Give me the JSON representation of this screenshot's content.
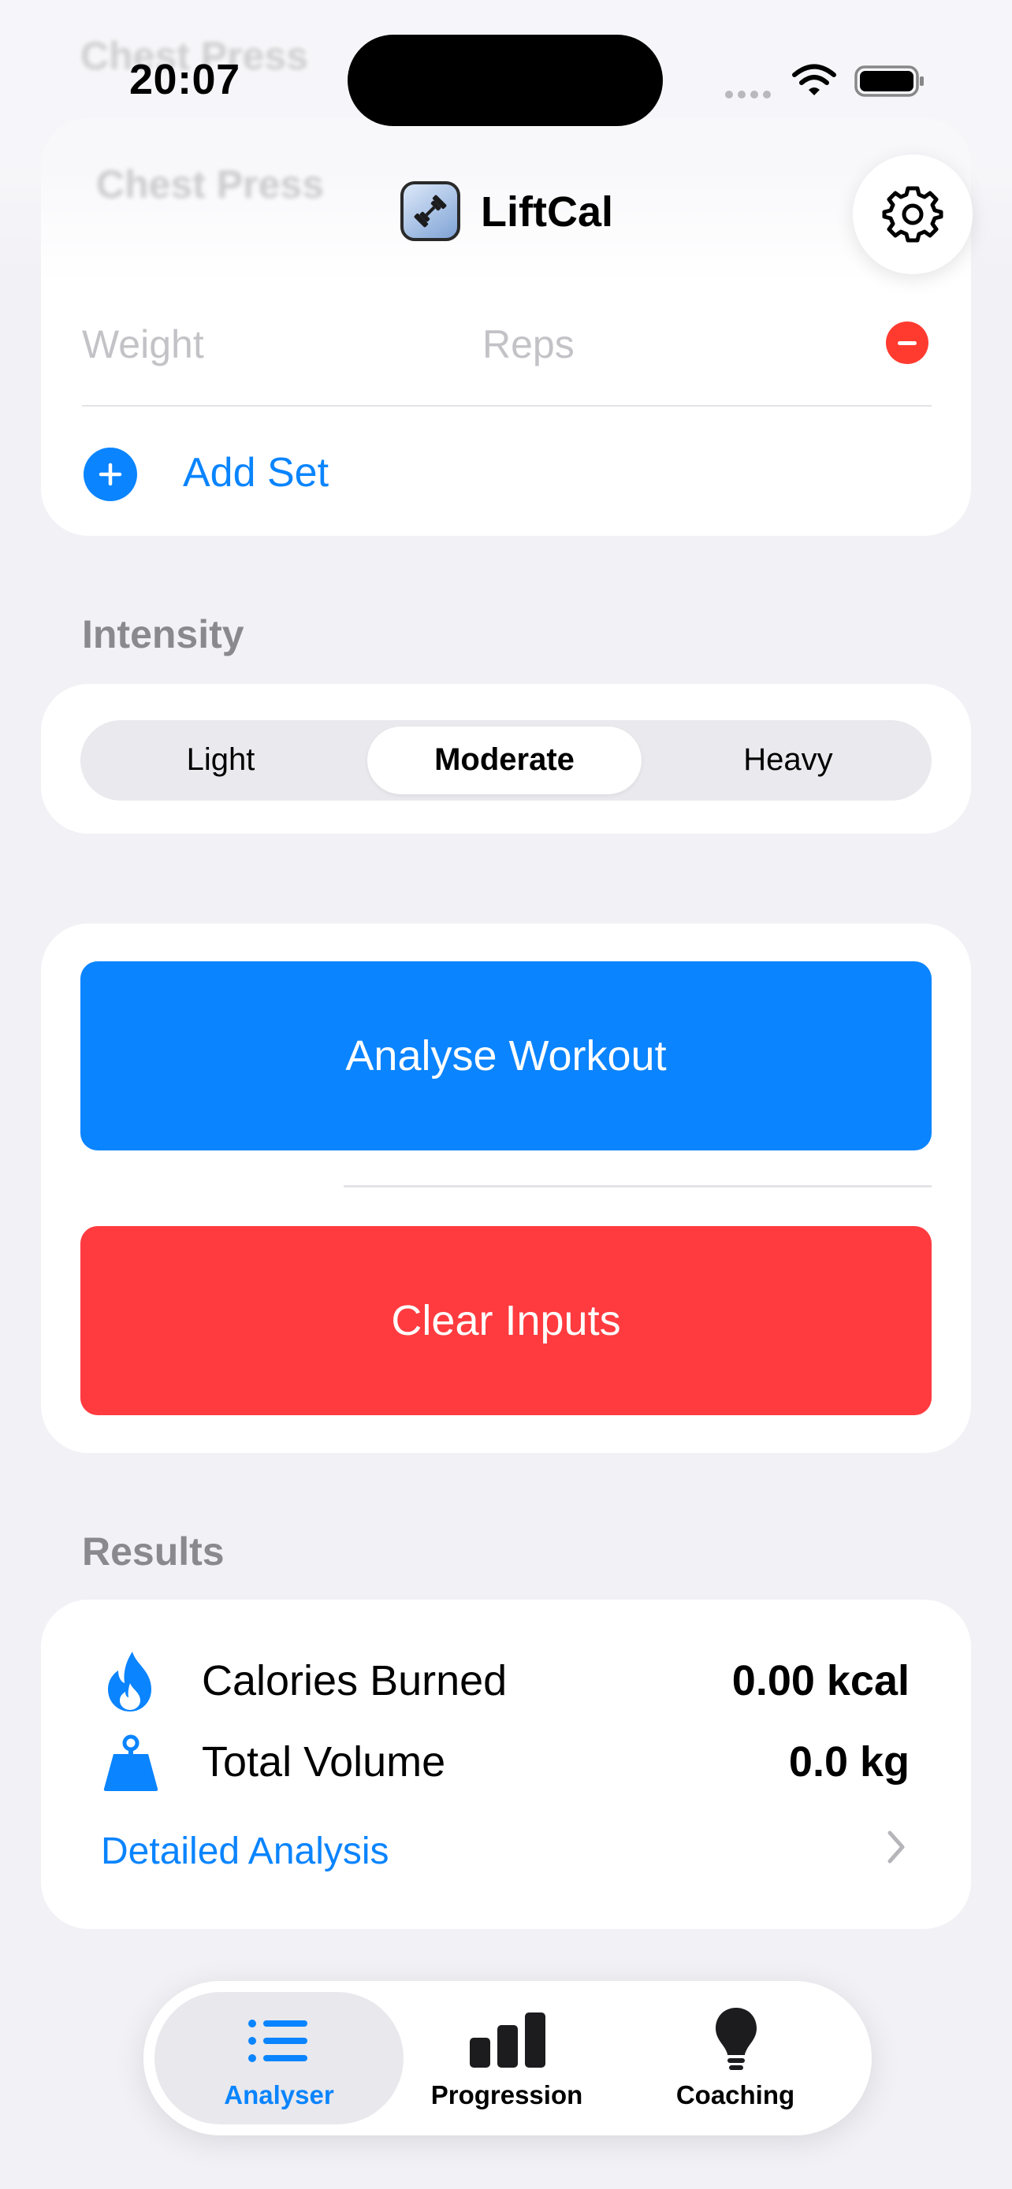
{
  "background_header": {
    "ghost_title": "Chest Press",
    "ghost_field": "Chest Press"
  },
  "status_bar": {
    "time": "20:07"
  },
  "nav": {
    "app_name": "LiftCal",
    "settings_icon": "gear-icon"
  },
  "sets": {
    "weight_placeholder": "Weight",
    "reps_placeholder": "Reps",
    "add_set_label": "Add Set"
  },
  "intensity": {
    "section_label": "Intensity",
    "options": [
      "Light",
      "Moderate",
      "Heavy"
    ],
    "selected": "Moderate"
  },
  "actions": {
    "analyse_label": "Analyse Workout",
    "clear_label": "Clear Inputs"
  },
  "results": {
    "section_label": "Results",
    "calories_label": "Calories Burned",
    "calories_value": "0.00 kcal",
    "volume_label": "Total Volume",
    "volume_value": "0.0 kg",
    "detail_link": "Detailed Analysis"
  },
  "tabs": [
    {
      "label": "Analyser",
      "icon": "list-icon",
      "selected": true
    },
    {
      "label": "Progression",
      "icon": "bar-chart-icon",
      "selected": false
    },
    {
      "label": "Coaching",
      "icon": "lightbulb-icon",
      "selected": false
    }
  ],
  "colors": {
    "accent": "#0a84ff",
    "destructive": "#ff3b3f",
    "background": "#f1f1f6"
  }
}
